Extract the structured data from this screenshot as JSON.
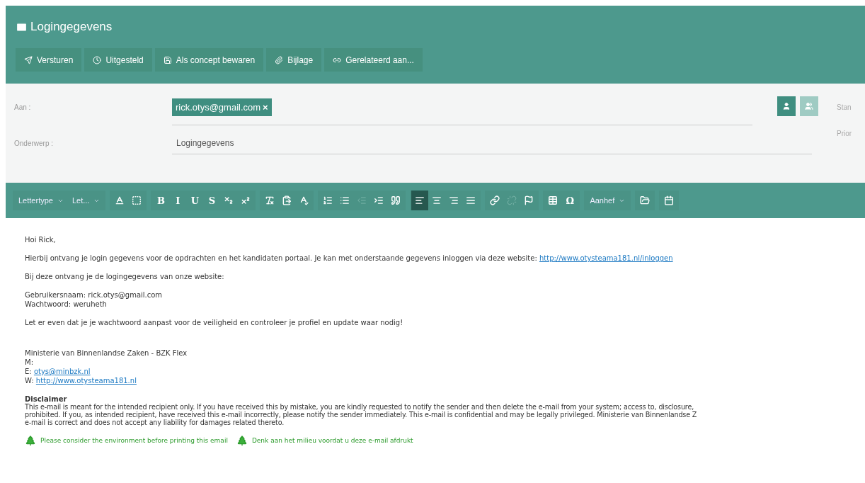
{
  "window": {
    "title": "Logingegevens"
  },
  "actions": [
    {
      "label": "Versturen"
    },
    {
      "label": "Uitgesteld"
    },
    {
      "label": "Als concept bewaren"
    },
    {
      "label": "Bijlage"
    },
    {
      "label": "Gerelateerd aan..."
    }
  ],
  "to": {
    "label": "Aan :",
    "recipients": [
      {
        "email": "rick.otys@gmail.com",
        "remove": "×"
      }
    ],
    "contact_button": {
      "disabled": false
    },
    "group_button": {
      "disabled": true
    }
  },
  "side_labels": [
    "Stan",
    "Prior"
  ],
  "subject": {
    "label": "Onderwerp :",
    "value": "Logingegevens"
  },
  "editor_toolbar": [
    {
      "items": [
        {
          "kind": "dropdown",
          "label": "Lettertype"
        },
        {
          "kind": "dropdown",
          "label": "Let..."
        }
      ]
    },
    {
      "items": [
        {
          "kind": "icon",
          "selected": false,
          "disabled": false
        },
        {
          "kind": "icon",
          "selected": false,
          "disabled": false
        }
      ]
    },
    {
      "items": [
        {
          "kind": "glyph",
          "label": "B",
          "selected": false,
          "disabled": false
        },
        {
          "kind": "glyph",
          "label": "I",
          "selected": false,
          "disabled": false
        },
        {
          "kind": "glyph",
          "label": "U",
          "selected": false,
          "disabled": false
        },
        {
          "kind": "glyph",
          "label": "S",
          "selected": false,
          "disabled": false
        },
        {
          "kind": "icon",
          "selected": false,
          "disabled": false
        },
        {
          "kind": "icon",
          "selected": false,
          "disabled": false
        }
      ]
    },
    {
      "items": [
        {
          "kind": "icon",
          "selected": false,
          "disabled": false
        },
        {
          "kind": "icon",
          "selected": false,
          "disabled": false
        },
        {
          "kind": "icon",
          "selected": false,
          "disabled": false
        }
      ]
    },
    {
      "items": [
        {
          "kind": "icon",
          "selected": false,
          "disabled": false
        },
        {
          "kind": "icon",
          "selected": false,
          "disabled": false
        },
        {
          "kind": "icon",
          "selected": false,
          "disabled": true
        },
        {
          "kind": "icon",
          "selected": false,
          "disabled": false
        },
        {
          "kind": "icon",
          "selected": false,
          "disabled": false
        }
      ]
    },
    {
      "items": [
        {
          "kind": "icon",
          "selected": true,
          "disabled": false
        },
        {
          "kind": "icon",
          "selected": false,
          "disabled": false
        },
        {
          "kind": "icon",
          "selected": false,
          "disabled": false
        },
        {
          "kind": "icon",
          "selected": false,
          "disabled": false
        }
      ]
    },
    {
      "items": [
        {
          "kind": "icon",
          "selected": false,
          "disabled": false
        },
        {
          "kind": "icon",
          "selected": false,
          "disabled": true
        },
        {
          "kind": "icon",
          "selected": false,
          "disabled": false
        }
      ]
    },
    {
      "items": [
        {
          "kind": "icon",
          "selected": false,
          "disabled": false
        },
        {
          "kind": "glyph",
          "label": "Ω",
          "selected": false,
          "disabled": false
        }
      ]
    },
    {
      "items": [
        {
          "kind": "dropdown",
          "label": "Aanhef"
        }
      ]
    },
    {
      "items": [
        {
          "kind": "icon",
          "selected": false,
          "disabled": false
        }
      ]
    },
    {
      "items": [
        {
          "kind": "icon",
          "selected": false,
          "disabled": false
        }
      ]
    }
  ],
  "body": {
    "paragraphs": [
      {
        "lines": [
          {
            "text": "Hoi Rick,"
          }
        ]
      },
      {
        "lines": [
          {
            "text": "Hierbij ontvang je login gegevens voor de opdrachten en het kandidaten portaal. Je kan met onderstaande gegevens inloggen via deze website: ",
            "link": "http://www.otysteama181.nl/inloggen"
          }
        ]
      },
      {
        "lines": [
          {
            "text": "Bij deze ontvang je de logingegevens van onze website:"
          }
        ]
      },
      {
        "lines": [
          {
            "text": "Gebruikersnaam: rick.otys@gmail.com"
          },
          {
            "text": "Wachtwoord: weruheth"
          }
        ]
      },
      {
        "lines": [
          {
            "text": "Let er even dat je je wachtwoord aanpast voor de veiligheid en controleer je profiel en update waar nodig!"
          }
        ]
      }
    ],
    "signature": [
      {
        "text": "Ministerie van Binnenlandse Zaken - BZK Flex"
      },
      {
        "text": "M:"
      },
      {
        "text": "E: ",
        "link": "otys@minbzk.nl"
      },
      {
        "text": "W: ",
        "link": "http://www.otysteama181.nl"
      }
    ],
    "disclaimer": {
      "title": "Disclaimer",
      "lines": [
        "This e-mail is meant for the intended recipient only. If you have received this by mistake, you are kindly requested to notify the sender and then delete the e-mail from your system; access to, disclosure,",
        "prohibited. If you, as intended recipient, have received this e-mail incorrectly, please notify the sender immediately. This e-mail is confidential and may be legally privileged. Ministerie van Binnenlandse Z",
        "e-mail is correct and does not accept any liability for damages related thereto."
      ]
    },
    "eco_notes": [
      "Please consider the environment before printing this email",
      "Denk aan het milieu voordat u deze e-mail afdrukt"
    ]
  }
}
